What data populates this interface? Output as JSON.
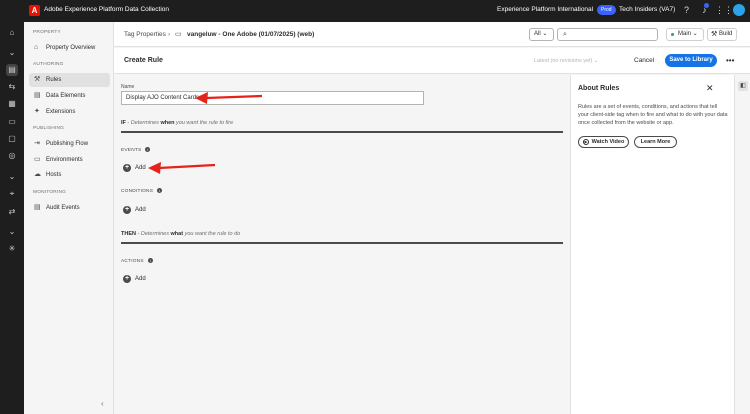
{
  "topbar": {
    "logo": "A",
    "app_name": "Adobe Experience Platform Data Collection",
    "org_name": "Experience Platform International",
    "env_badge": "Prod",
    "sandbox_name": "Tech Insiders (VA7)",
    "icons": [
      "help-icon",
      "bell-icon",
      "apps-grid-icon",
      "avatar"
    ]
  },
  "rail": {
    "icons": [
      "home-icon",
      "chevron-down-icon",
      "tags-icon",
      "events-forwarding-icon",
      "schemas-icon",
      "datastreams-icon",
      "monitor-icon",
      "identities-icon",
      "chevron-down-icon",
      "location-icon",
      "connections-icon",
      "chevron-down-icon",
      "graph-icon"
    ]
  },
  "sidenav": {
    "sections": [
      {
        "label": "PROPERTY",
        "items": [
          {
            "label": "Property Overview",
            "icon": "overview-icon"
          }
        ]
      },
      {
        "label": "AUTHORING",
        "items": [
          {
            "label": "Rules",
            "icon": "rules-icon",
            "active": true
          },
          {
            "label": "Data Elements",
            "icon": "data-elements-icon"
          },
          {
            "label": "Extensions",
            "icon": "extensions-icon"
          }
        ]
      },
      {
        "label": "PUBLISHING",
        "items": [
          {
            "label": "Publishing Flow",
            "icon": "publishing-flow-icon"
          },
          {
            "label": "Environments",
            "icon": "environments-icon"
          },
          {
            "label": "Hosts",
            "icon": "hosts-icon"
          }
        ]
      },
      {
        "label": "MONITORING",
        "items": [
          {
            "label": "Audit Events",
            "icon": "audit-events-icon"
          }
        ]
      }
    ]
  },
  "crumbbar": {
    "crumb": "Tag Properties",
    "separator": "›",
    "property": "vangeluw - One Adobe (01/07/2025) (web)",
    "filter": "All",
    "search_placeholder": "",
    "branch": "Main",
    "build": "Build"
  },
  "rulehead": {
    "title": "Create Rule",
    "revision": "Latest (no revisions yet)",
    "cancel": "Cancel",
    "save": "Save to Library",
    "more": "•••"
  },
  "form": {
    "name_label": "Name",
    "name_value": "Display AJO Content Cards",
    "if_label": "IF",
    "if_desc_pre": " - Determines ",
    "if_desc_bold": "when",
    "if_desc_post": " you want the rule to fire",
    "events_label": "EVENTS",
    "events_add": "Add",
    "conditions_label": "CONDITIONS",
    "conditions_add": "Add",
    "then_label": "THEN",
    "then_desc_pre": " - Determines ",
    "then_desc_bold": "what",
    "then_desc_post": " you want the rule to do",
    "actions_label": "ACTIONS",
    "actions_add": "Add"
  },
  "panel": {
    "title": "About Rules",
    "description": "Rules are a set of events, conditions, and actions that tell your client-side tag when to fire and what to do with your data once collected from the website or app.",
    "watch_video": "Watch Video",
    "learn_more": "Learn More"
  },
  "colors": {
    "accent": "#1473e6",
    "annotation_arrow": "#e5231b",
    "brand": "#eb1000"
  }
}
